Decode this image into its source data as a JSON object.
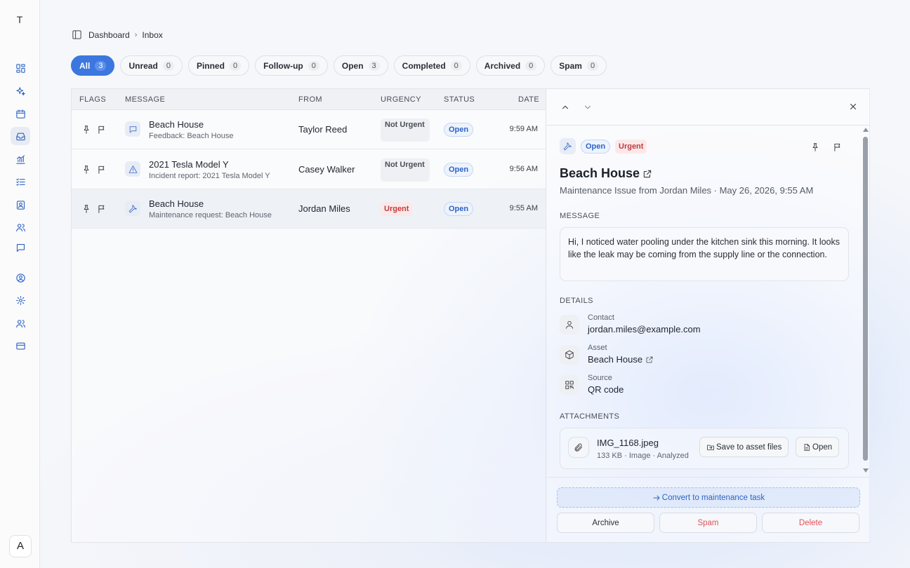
{
  "app": {
    "workspace_initial": "T",
    "user_initial": "A"
  },
  "sidebar": {
    "items": [
      {
        "icon": "dashboard-icon"
      },
      {
        "icon": "sparkles-icon"
      },
      {
        "icon": "calendar-icon"
      },
      {
        "icon": "inbox-icon",
        "active": true
      },
      {
        "icon": "chart-icon"
      },
      {
        "icon": "checklist-icon"
      },
      {
        "icon": "contacts-book-icon"
      },
      {
        "icon": "users-icon"
      },
      {
        "icon": "chat-icon"
      },
      {
        "icon": "account-icon"
      },
      {
        "icon": "settings-icon"
      },
      {
        "icon": "team-icon"
      },
      {
        "icon": "billing-card-icon"
      }
    ]
  },
  "breadcrumb": {
    "root": "Dashboard",
    "current": "Inbox"
  },
  "filters": [
    {
      "label": "All",
      "count": "3",
      "active": true
    },
    {
      "label": "Unread",
      "count": "0"
    },
    {
      "label": "Pinned",
      "count": "0"
    },
    {
      "label": "Follow-up",
      "count": "0"
    },
    {
      "label": "Open",
      "count": "3"
    },
    {
      "label": "Completed",
      "count": "0"
    },
    {
      "label": "Archived",
      "count": "0"
    },
    {
      "label": "Spam",
      "count": "0"
    }
  ],
  "table": {
    "headers": {
      "flags": "FLAGS",
      "message": "MESSAGE",
      "from": "FROM",
      "urgency": "URGENCY",
      "status": "STATUS",
      "date": "DATE"
    },
    "rows": [
      {
        "type_icon": "chat-bubble-icon",
        "title": "Beach House",
        "subtitle": "Feedback: Beach House",
        "from": "Taylor Reed",
        "urgency": "Not Urgent",
        "status": "Open",
        "date": "9:59 AM"
      },
      {
        "type_icon": "warning-triangle-icon",
        "title": "2021 Tesla Model Y",
        "subtitle": "Incident report: 2021 Tesla Model Y",
        "from": "Casey Walker",
        "urgency": "Not Urgent",
        "status": "Open",
        "date": "9:56 AM"
      },
      {
        "type_icon": "wrench-icon",
        "title": "Beach House",
        "subtitle": "Maintenance request: Beach House",
        "from": "Jordan Miles",
        "urgency": "Urgent",
        "status": "Open",
        "date": "9:55 AM",
        "selected": true
      }
    ]
  },
  "detail": {
    "status": "Open",
    "urgency": "Urgent",
    "title": "Beach House",
    "meta": "Maintenance Issue from Jordan Miles · May 26, 2026, 9:55 AM",
    "message_label": "MESSAGE",
    "message": "Hi, I noticed water pooling under the kitchen sink this morning. It looks like the leak may be coming from the supply line or the connection.",
    "details_label": "DETAILS",
    "contact_label": "Contact",
    "contact_value": "jordan.miles@example.com",
    "asset_label": "Asset",
    "asset_value": "Beach House",
    "source_label": "Source",
    "source_value": "QR code",
    "attachments_label": "ATTACHMENTS",
    "attachment": {
      "name": "IMG_1168.jpeg",
      "meta": "133 KB · Image · Analyzed",
      "save_label": "Save to asset files",
      "open_label": "Open"
    },
    "convert_label": "Convert to maintenance task",
    "archive_label": "Archive",
    "spam_label": "Spam",
    "delete_label": "Delete"
  },
  "colors": {
    "accent": "#3b77df",
    "urgent": "#c33b3f",
    "danger": "#e0525a"
  }
}
